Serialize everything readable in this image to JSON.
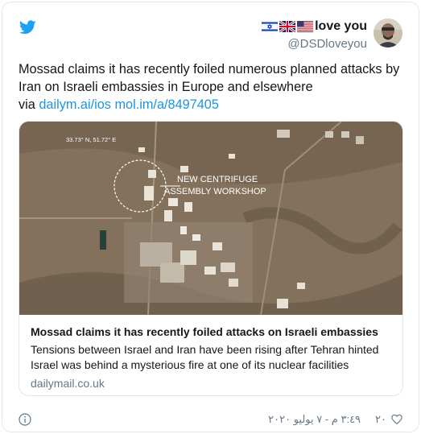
{
  "author": {
    "display_name_text": "love you",
    "flags": [
      "israel-flag",
      "uk-flag",
      "us-flag"
    ],
    "handle": "@DSDloveyou"
  },
  "tweet": {
    "text_main": "Mossad claims it has recently foiled numerous planned attacks by Iran on Israeli embassies in Europe and elsewhere",
    "via_label": "via",
    "link1": "dailym.ai/ios",
    "link2": "mol.im/a/8497405"
  },
  "card": {
    "image_caption_coords": "33.73° N, 51.72° E",
    "image_caption_line1": "NEW CENTRIFUGE",
    "image_caption_line2": "ASSEMBLY WORKSHOP",
    "title": "Mossad claims it has recently foiled attacks on Israeli embassies",
    "description": "Tensions between Israel and Iran have been rising after Tehran hinted Israel was behind a mysterious fire at one of its nuclear facilities",
    "domain": "dailymail.co.uk"
  },
  "footer": {
    "timestamp": "٣:٤٩ م - ٧ يوليو ٢٠٢٠",
    "like_count": "٢٠"
  },
  "colors": {
    "twitter_blue": "#1da1f2",
    "link_blue": "#1b95e0",
    "text": "#14171a",
    "muted": "#657786",
    "border": "#e1e8ed"
  }
}
